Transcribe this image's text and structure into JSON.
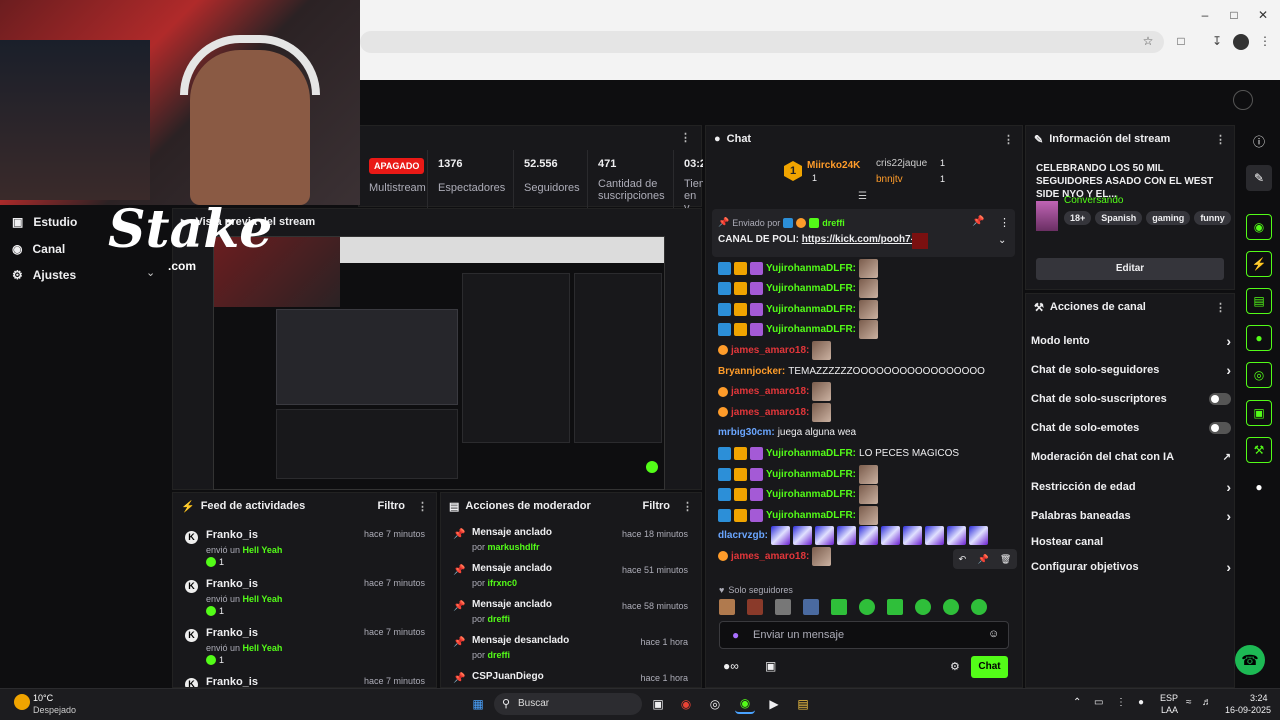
{
  "nav": {
    "studio": "Estudio",
    "channel": "Canal",
    "settings": "Ajustes"
  },
  "overlay": {
    "logo": "Stake",
    "logo_sub": ".com"
  },
  "stats": [
    {
      "value": "APAGADO",
      "label": "Multistream"
    },
    {
      "value": "1376",
      "label": "Espectadores"
    },
    {
      "value": "52.556",
      "label": "Seguidores"
    },
    {
      "value": "471",
      "label": "Cantidad de suscripciones"
    },
    {
      "value": "03:2",
      "label": "Tiem en v"
    }
  ],
  "preview": {
    "title": "Vista previa del stream"
  },
  "feed": {
    "title": "Feed de actividades",
    "filter": "Filtro",
    "items": [
      {
        "user": "Franko_is",
        "action": "envió un",
        "gift": "Hell Yeah",
        "count": "1",
        "time": "hace 7 minutos"
      },
      {
        "user": "Franko_is",
        "action": "envió un",
        "gift": "Hell Yeah",
        "count": "1",
        "time": "hace 7 minutos"
      },
      {
        "user": "Franko_is",
        "action": "envió un",
        "gift": "Hell Yeah",
        "count": "1",
        "time": "hace 7 minutos"
      },
      {
        "user": "Franko_is",
        "action": "",
        "gift": "",
        "count": "",
        "time": "hace 7 minutos"
      }
    ]
  },
  "mod": {
    "title": "Acciones de moderador",
    "filter": "Filtro",
    "items": [
      {
        "action": "Mensaje anclado",
        "by": "por",
        "user": "markushdlfr",
        "time": "hace 18 minutos"
      },
      {
        "action": "Mensaje anclado",
        "by": "por",
        "user": "ifrxnc0",
        "time": "hace 51 minutos"
      },
      {
        "action": "Mensaje anclado",
        "by": "por",
        "user": "dreffi",
        "time": "hace 58 minutos"
      },
      {
        "action": "Mensaje desanclado",
        "by": "por",
        "user": "dreffi",
        "time": "hace 1 hora"
      },
      {
        "action": "CSPJuanDiego",
        "by": "",
        "user": "",
        "time": "hace 1 hora"
      }
    ]
  },
  "chat": {
    "title": "Chat",
    "top": [
      {
        "rank": "1",
        "name": "Miircko24K",
        "count": "1"
      },
      {
        "name": "cris22jaque",
        "count": "1"
      },
      {
        "name": "bnnjtv",
        "count": "1"
      }
    ],
    "pinned": {
      "sent_by": "Enviado por",
      "user": "dreffi",
      "text": "CANAL DE POLI:",
      "link": "https://kick.com/pooh7-7"
    },
    "lines": [
      {
        "user": "YujirohanmaDLFR:",
        "text": "",
        "style": "g",
        "badges": true,
        "emote": true
      },
      {
        "user": "YujirohanmaDLFR:",
        "text": "",
        "style": "g",
        "badges": true,
        "emote": true
      },
      {
        "user": "YujirohanmaDLFR:",
        "text": "",
        "style": "g",
        "badges": true,
        "emote": true
      },
      {
        "user": "YujirohanmaDLFR:",
        "text": "",
        "style": "g",
        "badges": true,
        "emote": true
      },
      {
        "user": "james_amaro18:",
        "text": "",
        "style": "r",
        "badges": false,
        "emote": true
      },
      {
        "user": "Bryannjocker:",
        "text": "TEMAZZZZZZOOOOOOOOOOOOOOOOO",
        "style": "o",
        "badges": false,
        "emote": false
      },
      {
        "user": "james_amaro18:",
        "text": "",
        "style": "r",
        "badges": false,
        "emote": true
      },
      {
        "user": "james_amaro18:",
        "text": "",
        "style": "r",
        "badges": false,
        "emote": true
      },
      {
        "user": "mrbig30cm:",
        "text": "juega alguna wea",
        "style": "b",
        "badges": false,
        "emote": false
      },
      {
        "user": "YujirohanmaDLFR:",
        "text": "LO PECES MAGICOS",
        "style": "g",
        "badges": true,
        "emote": false
      },
      {
        "user": "YujirohanmaDLFR:",
        "text": "",
        "style": "g",
        "badges": true,
        "emote": true
      },
      {
        "user": "YujirohanmaDLFR:",
        "text": "",
        "style": "g",
        "badges": true,
        "emote": true
      },
      {
        "user": "YujirohanmaDLFR:",
        "text": "",
        "style": "g",
        "badges": true,
        "emote": true
      },
      {
        "user": "dlacrvzgb:",
        "text": "",
        "style": "b",
        "badges": false,
        "emote": true
      },
      {
        "user": "james_amaro18:",
        "text": "",
        "style": "r",
        "badges": false,
        "emote": true
      }
    ],
    "followers_only": "Solo seguidores",
    "input_placeholder": "Enviar un mensaje",
    "send_label": "Chat"
  },
  "info": {
    "title": "Información del stream",
    "stream_title": "CELEBRANDO LOS 50 MIL SEGUIDORES ASADO CON EL WEST SIDE NYO Y EL...",
    "category": "Conversando",
    "tags": [
      "18+",
      "Spanish",
      "gaming",
      "funny"
    ],
    "edit_label": "Editar"
  },
  "actions": {
    "title": "Acciones de canal",
    "items": [
      {
        "label": "Modo lento",
        "control": "chevron"
      },
      {
        "label": "Chat de solo-seguidores",
        "control": "chevron"
      },
      {
        "label": "Chat de solo-suscriptores",
        "control": "toggle"
      },
      {
        "label": "Chat de solo-emotes",
        "control": "toggle"
      },
      {
        "label": "Moderación del chat con IA",
        "control": "external"
      },
      {
        "label": "Restricción de edad",
        "control": "chevron"
      },
      {
        "label": "Palabras baneadas",
        "control": "chevron"
      },
      {
        "label": "Hostear canal",
        "control": "none"
      },
      {
        "label": "Configurar objetivos",
        "control": "chevron"
      }
    ]
  },
  "taskbar": {
    "temp": "10°C",
    "weather": "Despejado",
    "search": "Buscar",
    "lang": "ESP",
    "lang_sub": "LAA",
    "time": "3:24",
    "date": "16-09-2025"
  },
  "colors": {
    "accent": "#53fc18",
    "live_red": "#e91916",
    "panel": "#18181b"
  }
}
